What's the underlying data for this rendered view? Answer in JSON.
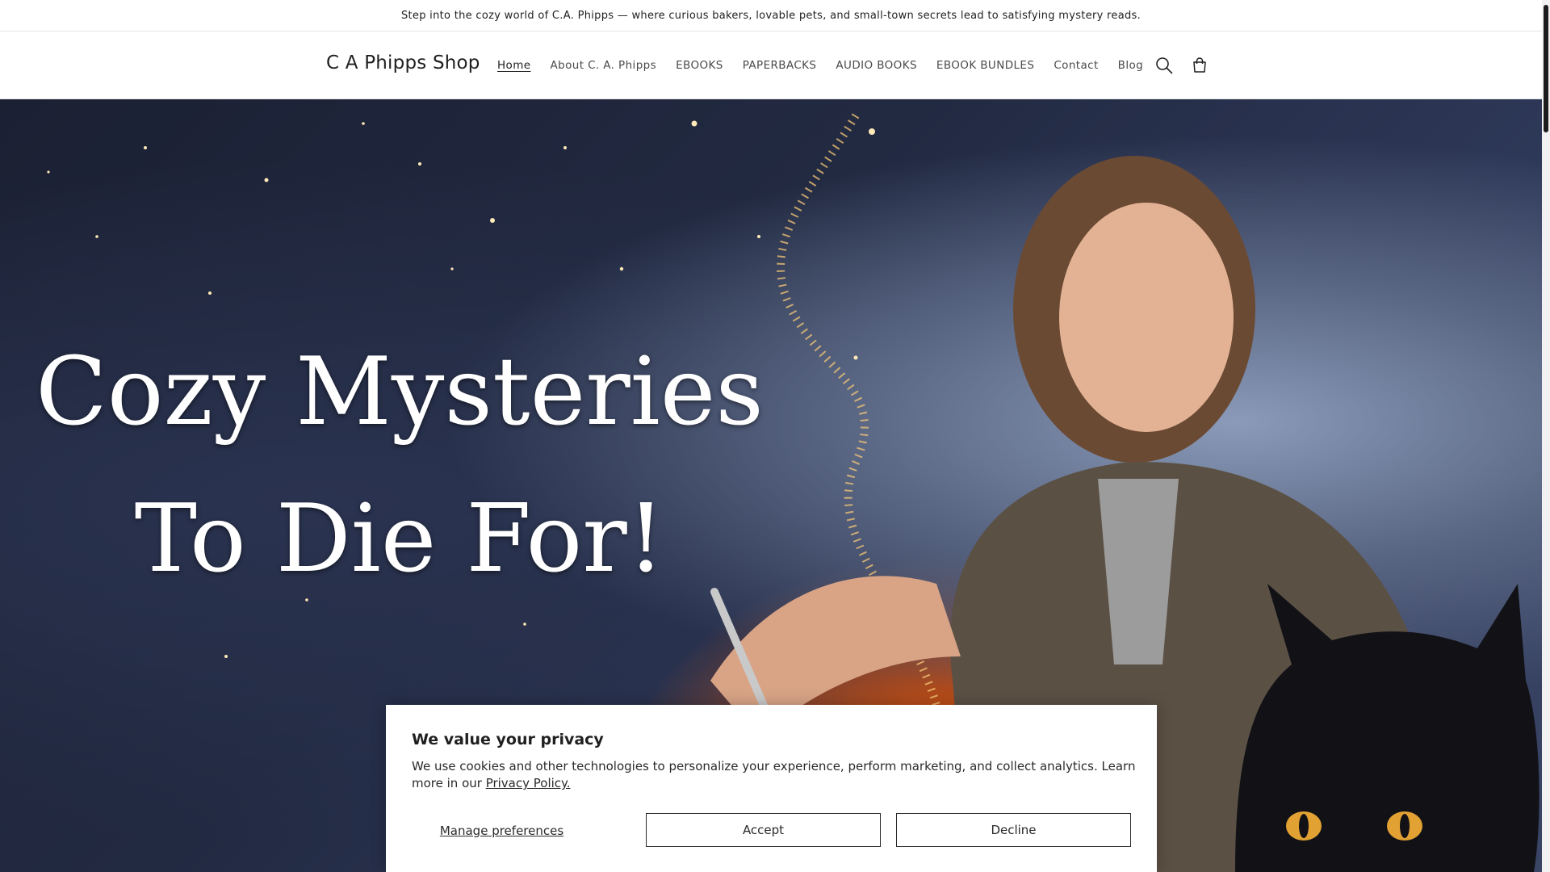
{
  "announcement": {
    "text": "Step into the cozy world of C.A. Phipps — where curious bakers, lovable pets, and small-town secrets lead to satisfying mystery reads."
  },
  "header": {
    "logo": "C A Phipps Shop",
    "nav": [
      {
        "label": "Home",
        "active": true
      },
      {
        "label": "About C. A. Phipps",
        "active": false
      },
      {
        "label": "EBOOKS",
        "active": false
      },
      {
        "label": "PAPERBACKS",
        "active": false
      },
      {
        "label": "AUDIO BOOKS",
        "active": false
      },
      {
        "label": "EBOOK BUNDLES",
        "active": false
      },
      {
        "label": "Contact",
        "active": false
      },
      {
        "label": "Blog",
        "active": false
      }
    ],
    "icons": {
      "search": "search-icon",
      "cart": "cart-icon"
    }
  },
  "hero": {
    "line1": "Cozy Mysteries",
    "line2": "To Die For!"
  },
  "cookie_banner": {
    "title": "We value your privacy",
    "text": "We use cookies and other technologies to personalize your experience, perform marketing, and collect analytics. Learn more in our",
    "link": "Privacy Policy.",
    "manage": "Manage preferences",
    "accept": "Accept",
    "decline": "Decline"
  },
  "colors": {
    "text": "#1f1f1f",
    "hero_dark": "#1b2033",
    "accent_orange": "#ff8a2a"
  }
}
